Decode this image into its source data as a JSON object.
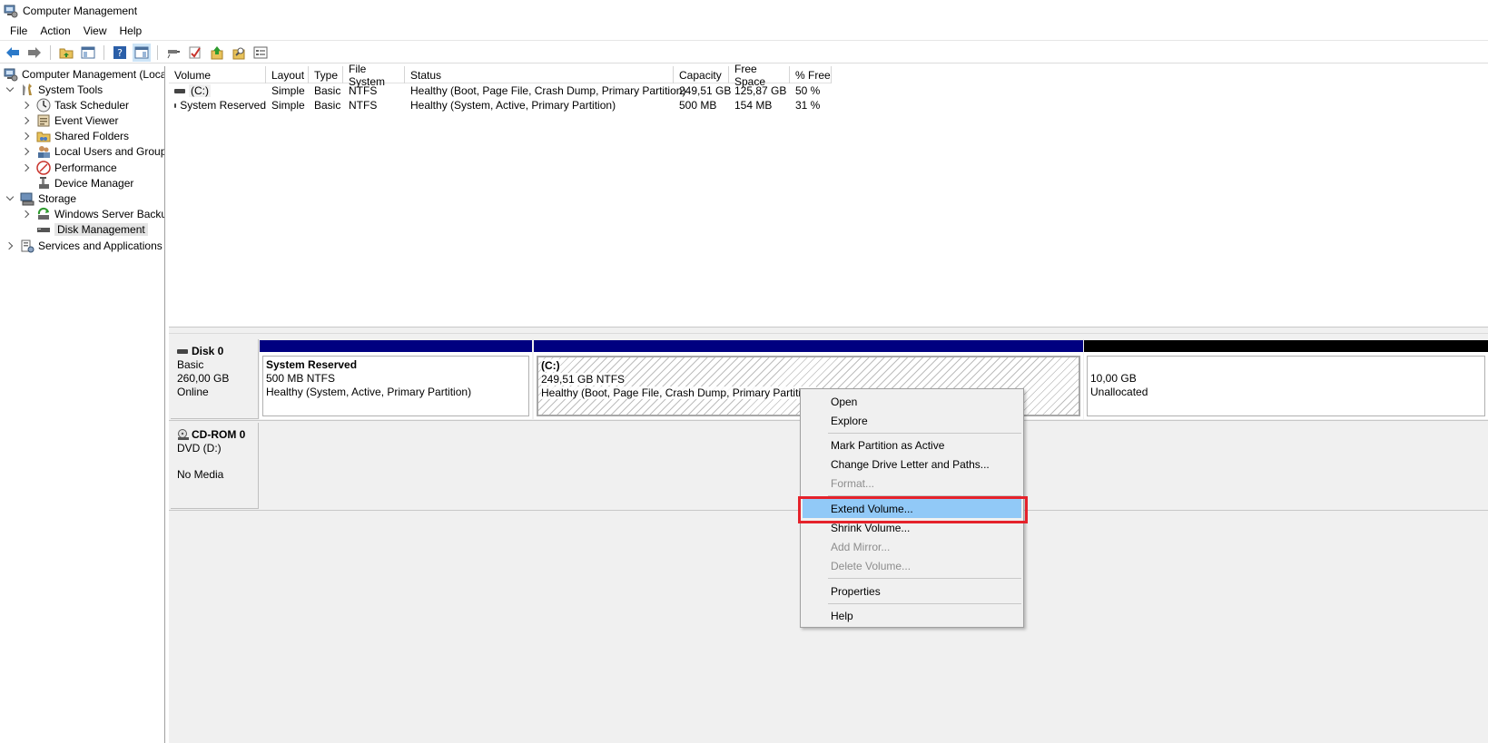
{
  "window": {
    "title": "Computer Management"
  },
  "menubar": [
    "File",
    "Action",
    "View",
    "Help"
  ],
  "tree": {
    "root": "Computer Management (Local",
    "system_tools": "System Tools",
    "task_scheduler": "Task Scheduler",
    "event_viewer": "Event Viewer",
    "shared_folders": "Shared Folders",
    "local_users": "Local Users and Groups",
    "performance": "Performance",
    "device_manager": "Device Manager",
    "storage": "Storage",
    "wsb": "Windows Server Backup",
    "disk_management": "Disk Management",
    "services": "Services and Applications"
  },
  "volume_list": {
    "headers": [
      "Volume",
      "Layout",
      "Type",
      "File System",
      "Status",
      "Capacity",
      "Free Space",
      "% Free"
    ],
    "rows": [
      [
        "(C:)",
        "Simple",
        "Basic",
        "NTFS",
        "Healthy (Boot, Page File, Crash Dump, Primary Partition)",
        "249,51 GB",
        "125,87 GB",
        "50 %"
      ],
      [
        "System Reserved",
        "Simple",
        "Basic",
        "NTFS",
        "Healthy (System, Active, Primary Partition)",
        "500 MB",
        "154 MB",
        "31 %"
      ]
    ]
  },
  "disks": {
    "disk0": {
      "name": "Disk 0",
      "type": "Basic",
      "size": "260,00 GB",
      "state": "Online",
      "partitions": {
        "sysres": {
          "title": "System Reserved",
          "size": "500 MB NTFS",
          "status": "Healthy (System, Active, Primary Partition)"
        },
        "c": {
          "title": "(C:)",
          "size": "249,51 GB NTFS",
          "status": "Healthy (Boot, Page File, Crash Dump, Primary Partition)"
        },
        "unalloc": {
          "size": "10,00 GB",
          "status": "Unallocated"
        }
      }
    },
    "cdrom0": {
      "name": "CD-ROM 0",
      "type": "DVD (D:)",
      "state": "No Media"
    }
  },
  "context_menu": {
    "open": "Open",
    "explore": "Explore",
    "mark_active": "Mark Partition as Active",
    "change_letter": "Change Drive Letter and Paths...",
    "format": "Format...",
    "extend": "Extend Volume...",
    "shrink": "Shrink Volume...",
    "add_mirror": "Add Mirror...",
    "delete": "Delete Volume...",
    "properties": "Properties",
    "help": "Help"
  },
  "colors": {
    "primary_partition_bar": "#000080",
    "unallocated_bar": "#000000",
    "highlight": "#91c9f7",
    "annotation_box": "#e5222b"
  }
}
